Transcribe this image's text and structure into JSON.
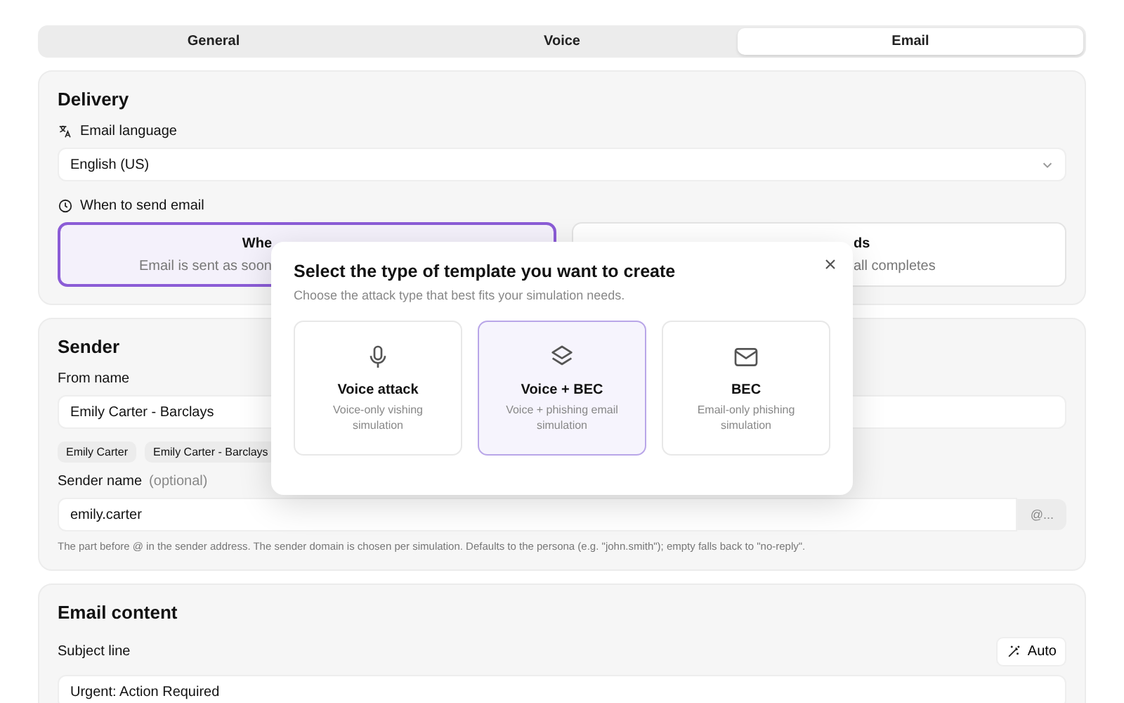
{
  "tabs": [
    {
      "label": "General",
      "selected": false
    },
    {
      "label": "Voice",
      "selected": false
    },
    {
      "label": "Email",
      "selected": true
    }
  ],
  "delivery": {
    "title": "Delivery",
    "language_label": "Email language",
    "language_value": "English (US)",
    "when_label": "When to send email",
    "options": [
      {
        "title": "Whe",
        "description": "Email is sent as soon",
        "selected": true
      },
      {
        "title": "ds",
        "description": "all completes",
        "selected": false
      }
    ]
  },
  "sender": {
    "title": "Sender",
    "from_label": "From name",
    "from_value": "Emily Carter - Barclays",
    "chips": [
      "Emily Carter",
      "Emily Carter - Barclays"
    ],
    "sender_label": "Sender name",
    "sender_optional": "(optional)",
    "sender_value": "emily.carter",
    "domain_suffix": "@...",
    "hint": "The part before @ in the sender address. The sender domain is chosen per simulation. Defaults to the persona (e.g. \"john.smith\"); empty falls back to \"no-reply\"."
  },
  "email_content": {
    "title": "Email content",
    "subject_label": "Subject line",
    "auto_button": "Auto",
    "subject_value": "Urgent: Action Required"
  },
  "modal": {
    "title": "Select the type of template you want to create",
    "subtitle": "Choose the attack type that best fits your simulation needs.",
    "types": [
      {
        "kind": "mic",
        "title": "Voice attack",
        "description": "Voice-only vishing simulation",
        "selected": false
      },
      {
        "kind": "layers",
        "title": "Voice + BEC",
        "description": "Voice + phishing email simulation",
        "selected": true
      },
      {
        "kind": "mail",
        "title": "BEC",
        "description": "Email-only phishing simulation",
        "selected": false
      }
    ]
  }
}
